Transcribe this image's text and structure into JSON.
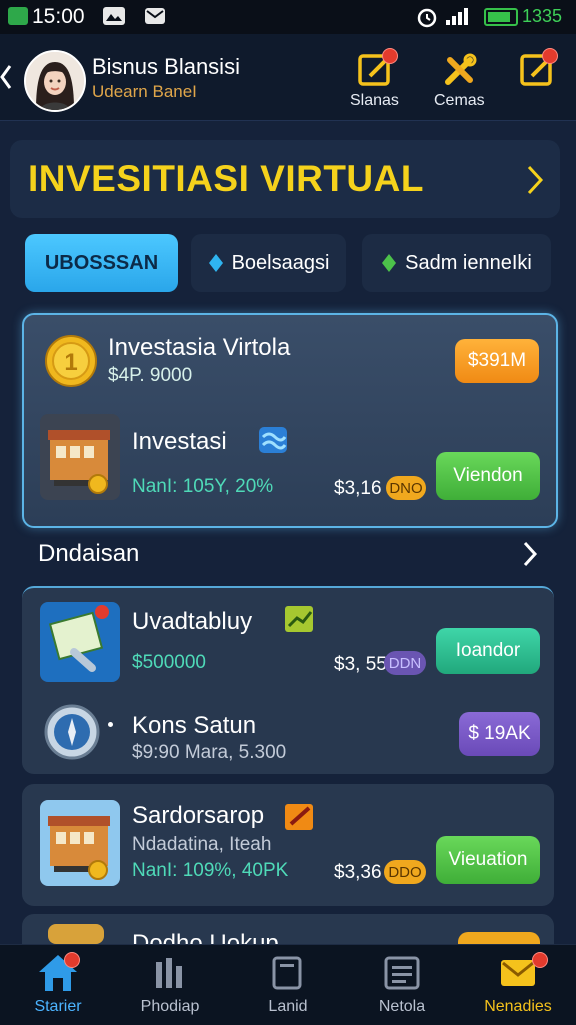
{
  "status": {
    "time": "15:00",
    "battery": "1335"
  },
  "header": {
    "name": "Bisnus Blansisi",
    "subtitle": "Udearn BaneI",
    "actions": [
      {
        "label": "Slanas",
        "icon": "edit-notify-icon"
      },
      {
        "label": "Cemas",
        "icon": "tools-icon"
      },
      {
        "label": "",
        "icon": "edit-icon"
      }
    ]
  },
  "banner": {
    "title": "INVESITIASI VIRTUAL"
  },
  "tabs": [
    {
      "label": "UBOSSSAN"
    },
    {
      "label": "Boelsaagsi"
    },
    {
      "label": "Sadm ienneIki"
    }
  ],
  "featured": {
    "row1": {
      "title": "Investasia Virtola",
      "amount": "$4P. 9000",
      "button": "$391M"
    },
    "row2": {
      "title": "Investasi",
      "rate": "NanI: 105Y, 20%",
      "price": "$3,16",
      "badge": "DNO",
      "button": "Viendon"
    }
  },
  "section": {
    "title": "Dndaisan"
  },
  "list1": {
    "row1": {
      "title": "Uvadtabluy",
      "amount": "$500000",
      "price": "$3, 55",
      "badge": "DDN",
      "button": "Ioandor"
    },
    "row2": {
      "title": "Kons Satun",
      "amount": "$9:90 Mara, 5.300",
      "button": "$ 19AK"
    }
  },
  "list2": {
    "title": "Sardorsarop",
    "subtitle": "Ndadatina, Iteah",
    "rate": "NanI: 109%, 40PK",
    "price": "$3,36",
    "badge": "DDO",
    "button": "Vieuation"
  },
  "list3": {
    "title": "Dodho Uokup"
  },
  "bottom_nav": [
    {
      "label": "Starier",
      "icon": "home-icon",
      "active": true
    },
    {
      "label": "Phodiap",
      "icon": "chart-icon"
    },
    {
      "label": "Lanid",
      "icon": "document-icon"
    },
    {
      "label": "Netola",
      "icon": "list-icon"
    },
    {
      "label": "Nenadies",
      "icon": "mail-icon",
      "active_color": "#f5c21c"
    }
  ],
  "colors": {
    "accent_yellow": "#f5d21c",
    "accent_blue": "#4cc8ff",
    "green": "#3fae38",
    "orange": "#f08a14"
  }
}
